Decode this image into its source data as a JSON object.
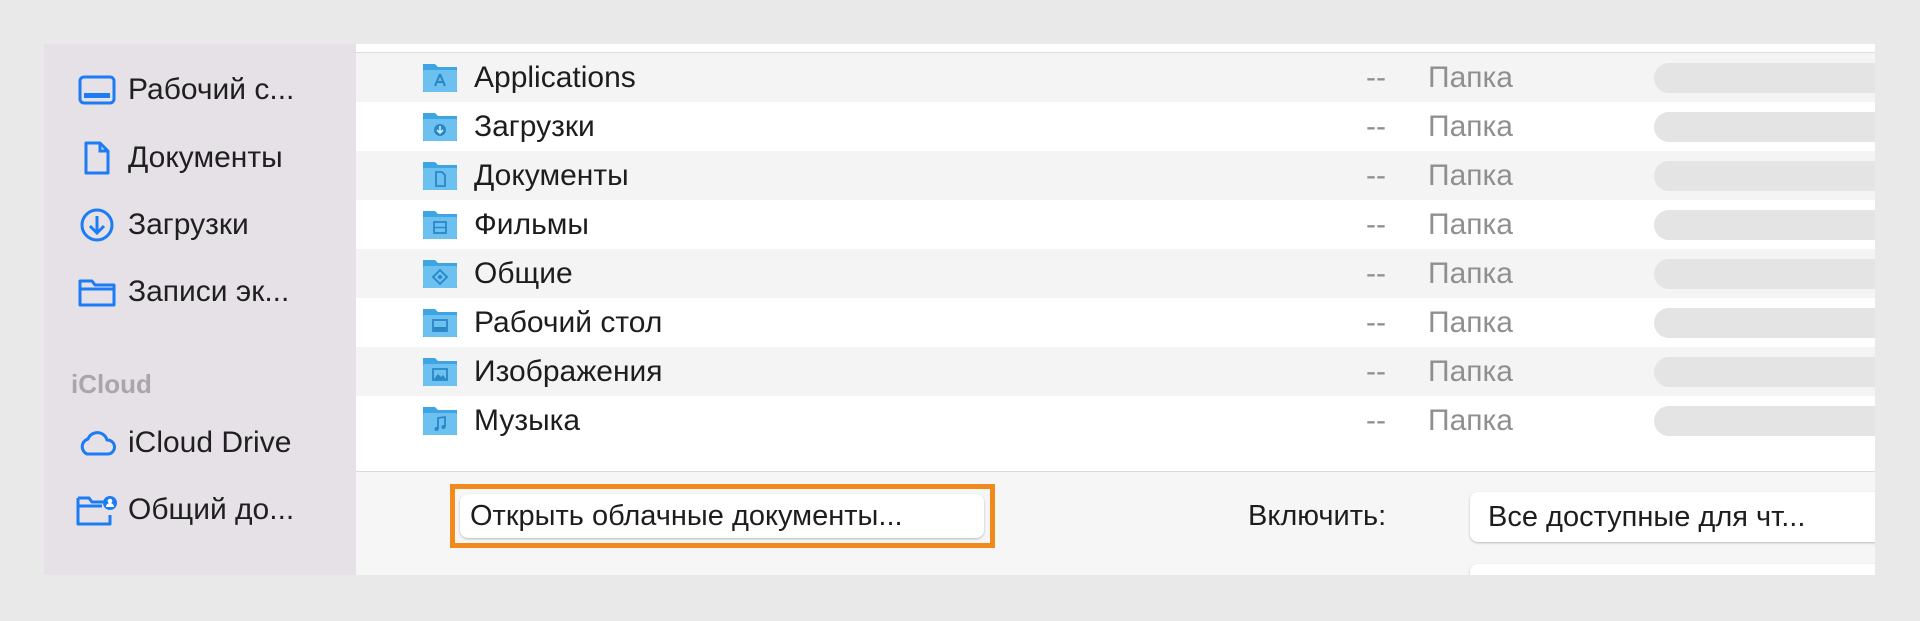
{
  "sidebar": {
    "items": [
      {
        "label": "Рабочий с...",
        "icon": "desktop-icon"
      },
      {
        "label": "Документы",
        "icon": "document-icon"
      },
      {
        "label": "Загрузки",
        "icon": "download-icon"
      },
      {
        "label": "Записи эк...",
        "icon": "folder-icon"
      }
    ],
    "section_title": "iCloud",
    "icloud_items": [
      {
        "label": "iCloud Drive",
        "icon": "cloud-icon"
      },
      {
        "label": "Общий до...",
        "icon": "shared-folder-icon"
      }
    ]
  },
  "files": [
    {
      "name": "Applications",
      "size": "--",
      "kind": "Папка",
      "icon": "applications-folder-icon"
    },
    {
      "name": "Загрузки",
      "size": "--",
      "kind": "Папка",
      "icon": "downloads-folder-icon"
    },
    {
      "name": "Документы",
      "size": "--",
      "kind": "Папка",
      "icon": "documents-folder-icon"
    },
    {
      "name": "Фильмы",
      "size": "--",
      "kind": "Папка",
      "icon": "movies-folder-icon"
    },
    {
      "name": "Общие",
      "size": "--",
      "kind": "Папка",
      "icon": "public-folder-icon"
    },
    {
      "name": "Рабочий стол",
      "size": "--",
      "kind": "Папка",
      "icon": "desktop-folder-icon"
    },
    {
      "name": "Изображения",
      "size": "--",
      "kind": "Папка",
      "icon": "pictures-folder-icon"
    },
    {
      "name": "Музыка",
      "size": "--",
      "kind": "Папка",
      "icon": "music-folder-icon"
    }
  ],
  "footer": {
    "open_cloud_button": "Открыть облачные документы...",
    "include_label": "Включить:",
    "include_value": "Все доступные для чт..."
  },
  "colors": {
    "accent": "#1b7cf5",
    "highlight": "#f08a1c",
    "sidebar_bg": "#e6e1e6",
    "folder": "#5fb7ee"
  }
}
